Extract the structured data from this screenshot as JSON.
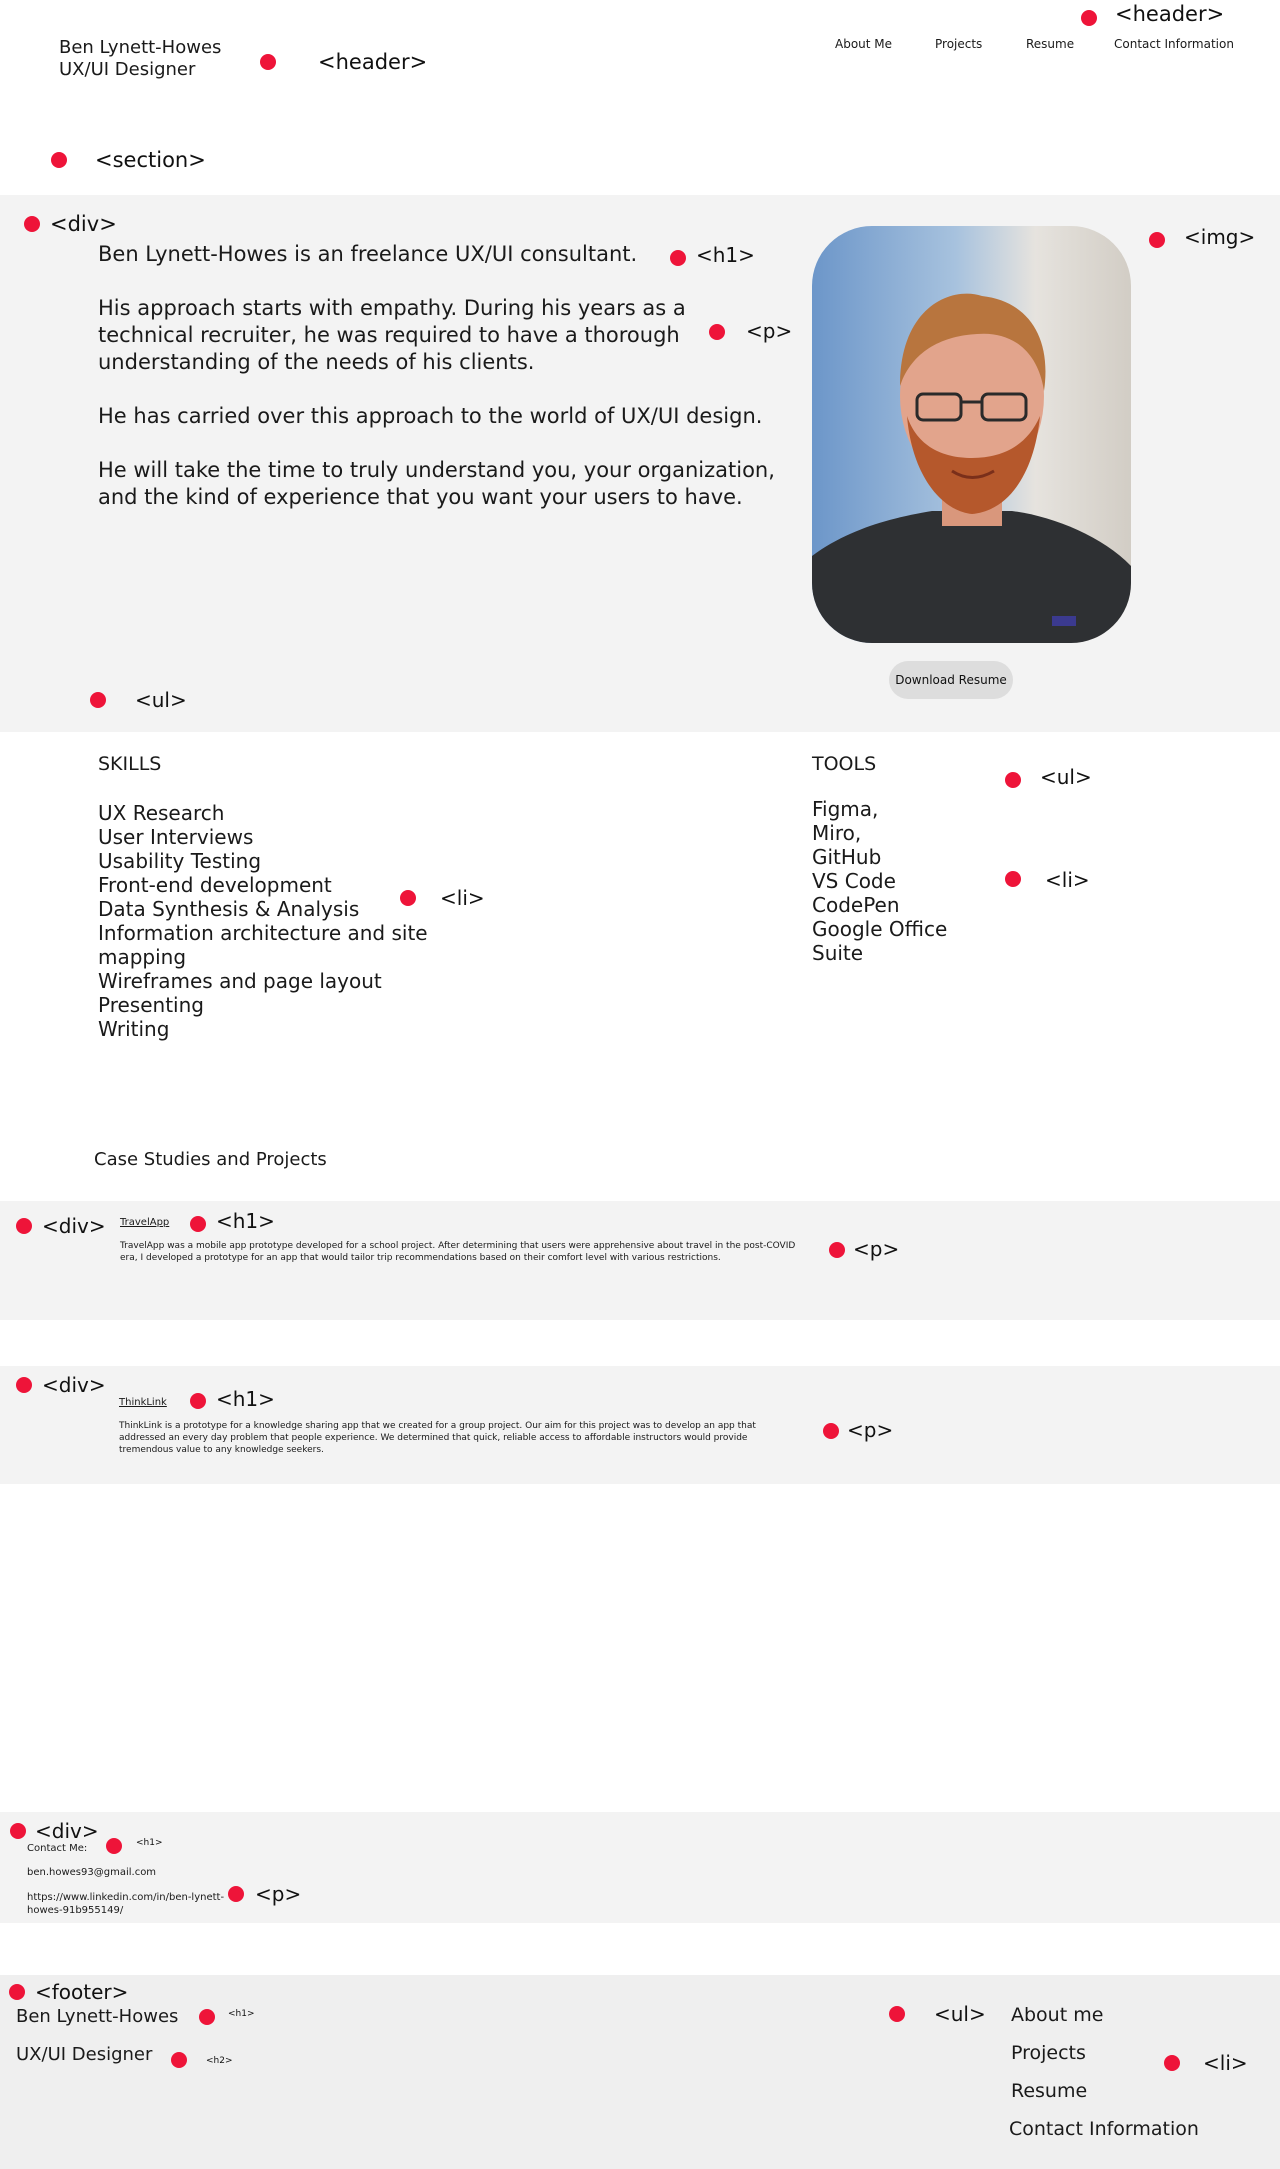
{
  "header": {
    "name": "Ben Lynett-Howes",
    "role": "UX/UI Designer",
    "nav": [
      "About Me",
      "Projects",
      "Resume",
      "Contact Information"
    ]
  },
  "about": {
    "headline": "Ben Lynett-Howes is an freelance UX/UI consultant.",
    "paragraphs": [
      "His approach starts with empathy. During his years as a technical recruiter, he was required to have a thorough understanding of the needs of his clients.",
      "He has carried over this approach to the world of UX/UI design.",
      "He will take the time to truly understand you, your organization, and the kind of experience that you want your users to have."
    ],
    "download_label": "Download Resume"
  },
  "skills": {
    "title": "SKILLS",
    "items": [
      "UX Research",
      "User Interviews",
      "Usability Testing",
      "Front-end development",
      "Data Synthesis & Analysis",
      "Information architecture and site mapping",
      "Wireframes and page layout",
      "Presenting",
      "Writing"
    ]
  },
  "tools": {
    "title": "TOOLS",
    "items": [
      "Figma,",
      "Miro,",
      "GitHub",
      "VS Code",
      "CodePen",
      "Google Office Suite"
    ]
  },
  "projects": {
    "title": "Case Studies and Projects",
    "items": [
      {
        "title": "TravelApp",
        "description": "TravelApp was a mobile app prototype developed for a school project. After determining that users were apprehensive about travel in the post-COVID era, I developed a prototype for an app that would tailor trip recommendations based on their comfort level with various restrictions."
      },
      {
        "title": "ThinkLink",
        "description": "ThinkLink is a prototype for a knowledge sharing app that we created for a group project. Our aim for this project was to develop an app that addressed an every day problem that people experience. We determined that quick, reliable access to affordable instructors would provide tremendous value to any knowledge seekers."
      }
    ]
  },
  "contact": {
    "title": "Contact Me:",
    "email": "ben.howes93@gmail.com",
    "linkedin": "https://www.linkedin.com/in/ben-lynett-howes-91b955149/"
  },
  "footer": {
    "name": "Ben Lynett-Howes",
    "role": "UX/UI Designer",
    "links": [
      "About me",
      "Projects",
      "Resume",
      "Contact Information"
    ]
  },
  "annotations": {
    "header_top": "<header>",
    "header": "<header>",
    "section": "<section>",
    "div": "<div>",
    "h1": "<h1>",
    "p": "<p>",
    "img": "<img>",
    "ul": "<ul>",
    "li": "<li>",
    "footer": "<footer>",
    "h2": "<h2>"
  },
  "colors": {
    "marker": "#ee1439",
    "band": "#f3f3f3",
    "footer_band": "#efefef",
    "button": "#dddddd"
  }
}
